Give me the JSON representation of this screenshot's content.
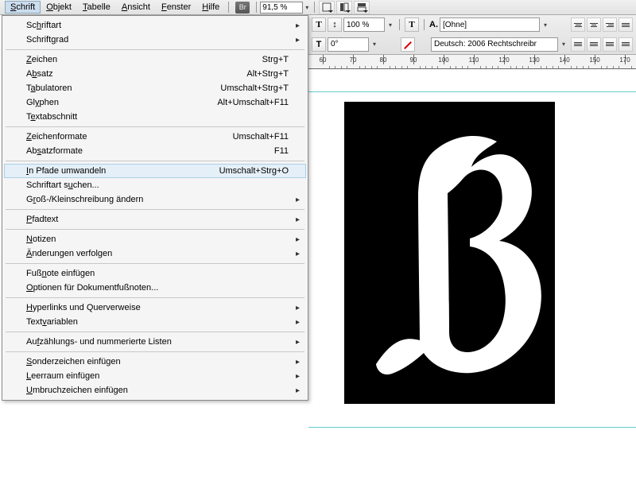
{
  "menubar": {
    "items": [
      {
        "pre": "",
        "u": "S",
        "post": "chrift"
      },
      {
        "pre": "",
        "u": "O",
        "post": "bjekt"
      },
      {
        "pre": "",
        "u": "T",
        "post": "abelle"
      },
      {
        "pre": "",
        "u": "A",
        "post": "nsicht"
      },
      {
        "pre": "",
        "u": "F",
        "post": "enster"
      },
      {
        "pre": "",
        "u": "H",
        "post": "ilfe"
      }
    ],
    "br": "Br",
    "zoom": "91,5 %"
  },
  "dropdown": {
    "items": [
      {
        "type": "item",
        "pre": "Sc",
        "u": "h",
        "post": "riftart",
        "sub": true
      },
      {
        "type": "item",
        "pre": "Schrift",
        "u": "g",
        "post": "rad",
        "sub": true
      },
      {
        "type": "sep"
      },
      {
        "type": "item",
        "pre": "",
        "u": "Z",
        "post": "eichen",
        "shortcut": "Strg+T"
      },
      {
        "type": "item",
        "pre": "A",
        "u": "b",
        "post": "satz",
        "shortcut": "Alt+Strg+T"
      },
      {
        "type": "item",
        "pre": "T",
        "u": "a",
        "post": "bulatoren",
        "shortcut": "Umschalt+Strg+T"
      },
      {
        "type": "item",
        "pre": "Gl",
        "u": "y",
        "post": "phen",
        "shortcut": "Alt+Umschalt+F11"
      },
      {
        "type": "item",
        "pre": "T",
        "u": "e",
        "post": "xtabschnitt"
      },
      {
        "type": "sep"
      },
      {
        "type": "item",
        "pre": "",
        "u": "Z",
        "post": "eichenformate",
        "shortcut": "Umschalt+F11"
      },
      {
        "type": "item",
        "pre": "Ab",
        "u": "s",
        "post": "atzformate",
        "shortcut": "F11"
      },
      {
        "type": "sep"
      },
      {
        "type": "item",
        "pre": "",
        "u": "I",
        "post": "n Pfade umwandeln",
        "shortcut": "Umschalt+Strg+O",
        "highlight": true
      },
      {
        "type": "item",
        "pre": "Schriftart s",
        "u": "u",
        "post": "chen..."
      },
      {
        "type": "item",
        "pre": "G",
        "u": "r",
        "post": "oß-/Kleinschreibung ändern",
        "sub": true
      },
      {
        "type": "sep"
      },
      {
        "type": "item",
        "pre": "",
        "u": "P",
        "post": "fadtext",
        "sub": true
      },
      {
        "type": "sep"
      },
      {
        "type": "item",
        "pre": "",
        "u": "N",
        "post": "otizen",
        "sub": true
      },
      {
        "type": "item",
        "pre": "",
        "u": "Ä",
        "post": "nderungen verfolgen",
        "sub": true
      },
      {
        "type": "sep"
      },
      {
        "type": "item",
        "pre": "Fuß",
        "u": "n",
        "post": "ote einfügen"
      },
      {
        "type": "item",
        "pre": "",
        "u": "O",
        "post": "ptionen für Dokumentfußnoten..."
      },
      {
        "type": "sep"
      },
      {
        "type": "item",
        "pre": "",
        "u": "H",
        "post": "yperlinks und Querverweise",
        "sub": true
      },
      {
        "type": "item",
        "pre": "Text",
        "u": "v",
        "post": "ariablen",
        "sub": true
      },
      {
        "type": "sep"
      },
      {
        "type": "item",
        "pre": "Au",
        "u": "f",
        "post": "zählungs- und nummerierte Listen",
        "sub": true
      },
      {
        "type": "sep"
      },
      {
        "type": "item",
        "pre": "",
        "u": "S",
        "post": "onderzeichen einfügen",
        "sub": true
      },
      {
        "type": "item",
        "pre": "",
        "u": "L",
        "post": "eerraum einfügen",
        "sub": true
      },
      {
        "type": "item",
        "pre": "",
        "u": "U",
        "post": "mbruchzeichen einfügen",
        "sub": true
      }
    ]
  },
  "toolbar2": {
    "size_pct": "100 %",
    "rotation": "0°",
    "style_none": "[Ohne]",
    "lang": "Deutsch: 2006 Rechtschreibr",
    "char_label": "A."
  },
  "ruler": {
    "ticks": [
      60,
      70,
      80,
      90,
      100,
      110,
      120,
      130,
      140,
      150,
      170
    ]
  }
}
